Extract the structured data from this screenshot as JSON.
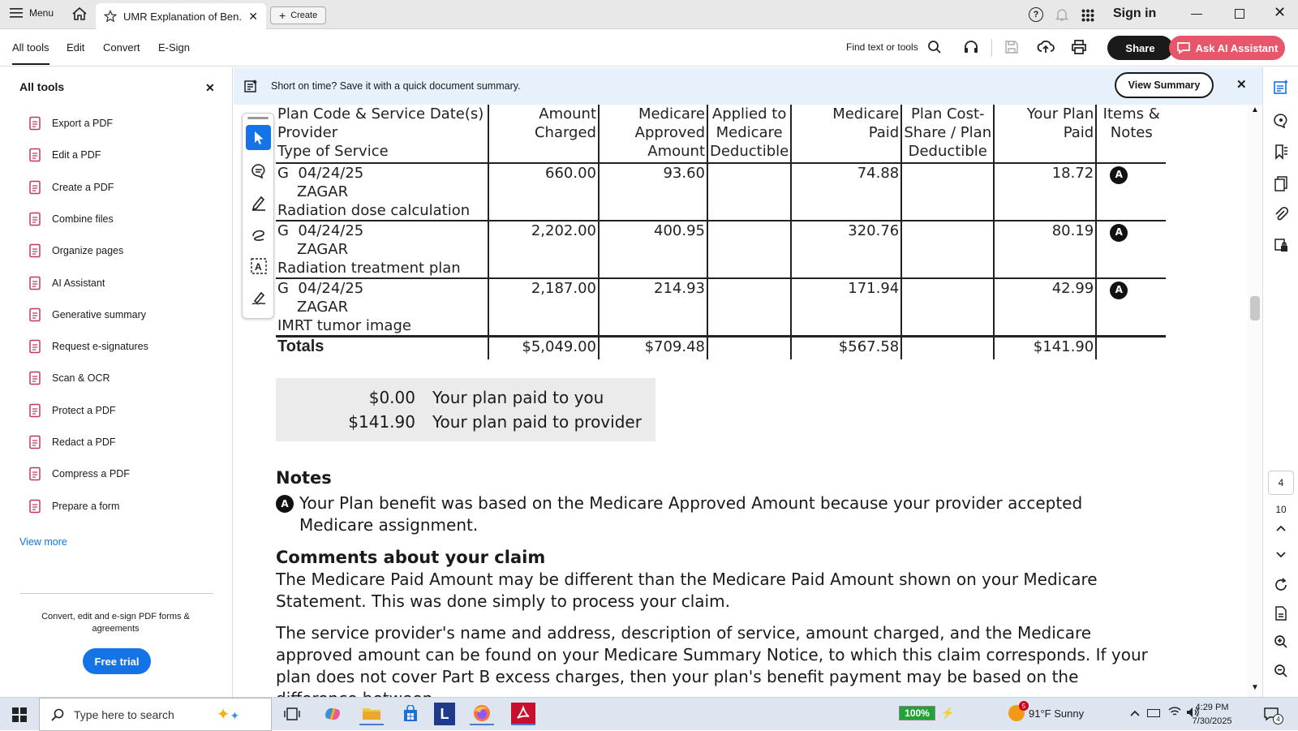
{
  "tabbar": {
    "menu_label": "Menu",
    "tab_title": "UMR Explanation of Ben...",
    "create_label": "Create",
    "signin_label": "Sign in"
  },
  "toolbar": {
    "menus": [
      "All tools",
      "Edit",
      "Convert",
      "E-Sign"
    ],
    "find_label": "Find text or tools",
    "share_label": "Share",
    "ai_label": "Ask AI Assistant"
  },
  "left_panel": {
    "title": "All tools",
    "items": [
      {
        "label": "Export a PDF",
        "icon": "export-pdf-icon"
      },
      {
        "label": "Edit a PDF",
        "icon": "edit-pdf-icon"
      },
      {
        "label": "Create a PDF",
        "icon": "create-pdf-icon"
      },
      {
        "label": "Combine files",
        "icon": "combine-files-icon"
      },
      {
        "label": "Organize pages",
        "icon": "organize-pages-icon"
      },
      {
        "label": "AI Assistant",
        "icon": "ai-assistant-icon"
      },
      {
        "label": "Generative summary",
        "icon": "generative-summary-icon"
      },
      {
        "label": "Request e-signatures",
        "icon": "e-signature-icon"
      },
      {
        "label": "Scan & OCR",
        "icon": "scan-ocr-icon"
      },
      {
        "label": "Protect a PDF",
        "icon": "protect-pdf-icon"
      },
      {
        "label": "Redact a PDF",
        "icon": "redact-pdf-icon"
      },
      {
        "label": "Compress a PDF",
        "icon": "compress-pdf-icon"
      },
      {
        "label": "Prepare a form",
        "icon": "prepare-form-icon"
      }
    ],
    "view_more": "View more",
    "promo_text": "Convert, edit and e-sign PDF forms & agreements",
    "free_trial": "Free trial"
  },
  "banner": {
    "message": "Short on time? Save it with a quick document summary.",
    "view_summary": "View Summary"
  },
  "eob_table": {
    "headers": {
      "plan_code": [
        "Plan Code & Service Date(s)",
        "Provider",
        "Type of Service"
      ],
      "amount_charged": [
        "Amount",
        "Charged"
      ],
      "medicare_approved": [
        "Medicare",
        "Approved",
        "Amount"
      ],
      "applied_deductible": [
        "Applied to",
        "Medicare",
        "Deductible"
      ],
      "medicare_paid": [
        "Medicare",
        "Paid"
      ],
      "plan_cost_share": [
        "Plan Cost-",
        "Share / Plan",
        "Deductible"
      ],
      "plan_paid": [
        "Your Plan",
        "Paid"
      ],
      "items_notes": [
        "Items &",
        "Notes"
      ]
    },
    "rows": [
      {
        "code_date": "G  04/24/25",
        "provider": "ZAGAR",
        "service": "Radiation dose calculation",
        "charged": "660.00",
        "approved": "93.60",
        "deductible": "",
        "medicare_paid": "74.88",
        "cost_share": "",
        "plan_paid": "18.72",
        "note": "A"
      },
      {
        "code_date": "G  04/24/25",
        "provider": "ZAGAR",
        "service": "Radiation treatment plan",
        "charged": "2,202.00",
        "approved": "400.95",
        "deductible": "",
        "medicare_paid": "320.76",
        "cost_share": "",
        "plan_paid": "80.19",
        "note": "A"
      },
      {
        "code_date": "G  04/24/25",
        "provider": "ZAGAR",
        "service": "IMRT tumor image",
        "charged": "2,187.00",
        "approved": "214.93",
        "deductible": "",
        "medicare_paid": "171.94",
        "cost_share": "",
        "plan_paid": "42.99",
        "note": "A"
      }
    ],
    "totals": {
      "label": "Totals",
      "charged": "$5,049.00",
      "approved": "$709.48",
      "medicare_paid": "$567.58",
      "plan_paid": "$141.90"
    }
  },
  "paid_box": {
    "to_you_amount": "$0.00",
    "to_you_label": "Your plan paid to you",
    "to_provider_amount": "$141.90",
    "to_provider_label": "Your plan paid to provider"
  },
  "notes": {
    "heading": "Notes",
    "badge": "A",
    "text": "Your Plan benefit was based on the Medicare Approved Amount because your provider accepted Medicare assignment."
  },
  "comments": {
    "heading": "Comments about your claim",
    "para1": "The Medicare Paid Amount may be different than the Medicare Paid Amount shown on your Medicare Statement. This was done simply to process your claim.",
    "para2": "The service provider's name and address, description of service, amount charged, and the Medicare approved amount can be found on your Medicare Summary Notice, to which this claim corresponds. If your plan does not cover Part B excess charges, then your plan's benefit payment may be based on the difference between"
  },
  "right_panel": {
    "page_current": "4",
    "page_total": "10"
  },
  "taskbar": {
    "search_placeholder": "Type here to search",
    "battery": "100%",
    "weather_badge": "5",
    "weather": "91°F  Sunny",
    "time": "4:29 PM",
    "date": "7/30/2025",
    "notif_count": "4"
  }
}
